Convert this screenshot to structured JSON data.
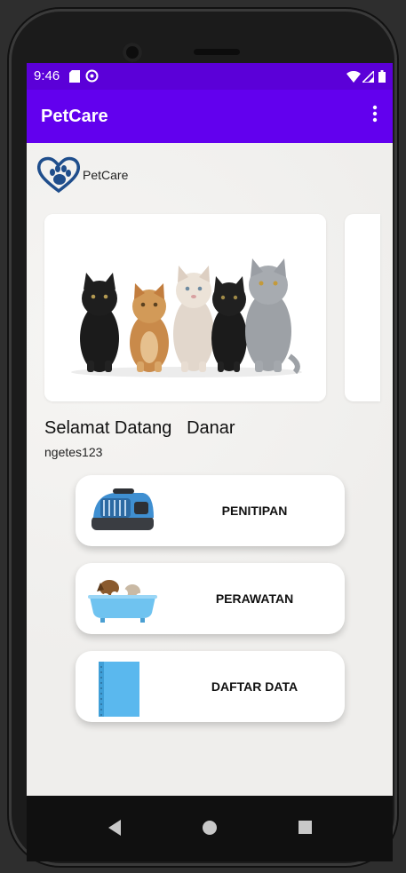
{
  "status_bar": {
    "time": "9:46",
    "icons": [
      "sd-card-icon",
      "sync-icon",
      "wifi-icon",
      "signal-icon",
      "battery-icon"
    ]
  },
  "app_bar": {
    "title": "PetCare",
    "menu_icon": "more-vert-icon"
  },
  "logo": {
    "text": "PetCare",
    "icon": "heart-paw-icon"
  },
  "carousel": {
    "image": "five-kittens-photo"
  },
  "welcome": {
    "greeting": "Selamat Datang",
    "name": "Danar",
    "subtitle": "ngetes123"
  },
  "menu": [
    {
      "label": "PENITIPAN",
      "icon": "pet-carrier-icon"
    },
    {
      "label": "PERAWATAN",
      "icon": "pet-bath-icon"
    },
    {
      "label": "DAFTAR DATA",
      "icon": "notebook-icon"
    }
  ],
  "colors": {
    "status_bar": "#5b00d8",
    "app_bar": "#6200ee",
    "logo_blue": "#1f4e8c",
    "background": "#f1f0ee"
  },
  "nav": {
    "back_icon": "back-triangle-icon",
    "home_icon": "home-circle-icon",
    "recent_icon": "recents-square-icon"
  }
}
